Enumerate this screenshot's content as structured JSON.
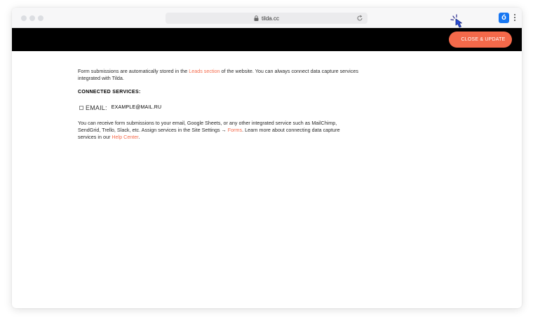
{
  "browser": {
    "url": "tilda.cc",
    "extension_badge": "ó"
  },
  "toolbar": {
    "close_update_label": "CLOSE & UPDATE"
  },
  "intro": {
    "text_before": "Form submissions are automatically stored in the ",
    "leads_link": "Leads section",
    "text_after": " of the website. You can always connect data capture services integrated with Tilda."
  },
  "connected": {
    "title": "CONNECTED SERVICES:",
    "service_name": "EMAIL:",
    "service_value": "EXAMPLE@MAIL.RU"
  },
  "info": {
    "text1": "You can receive form submissions to your email, Google Sheets, or any other integrated service such as MailChimp, SendGrid, Trello, Slack, etc. Assign services in the Site Settings → ",
    "forms_link": "Forms",
    "text2": ". Learn more about connecting data capture services in our ",
    "help_link": "Help Center",
    "text3": "."
  },
  "colors": {
    "accent": "#f4694a",
    "topbar": "#000000",
    "extension": "#1877f2"
  }
}
